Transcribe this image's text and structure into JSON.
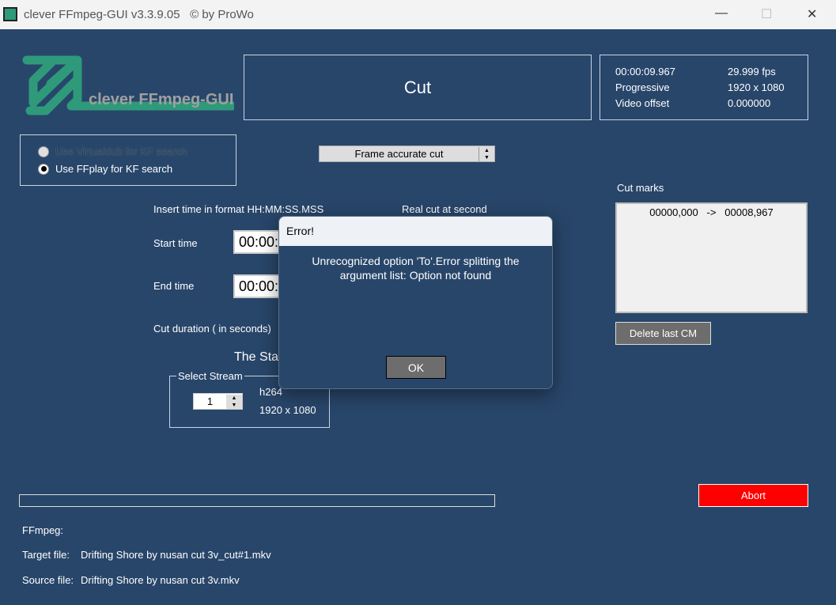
{
  "window": {
    "title": "clever FFmpeg-GUI v3.3.9.05",
    "copyright": "© by ProWo",
    "minimize": "—",
    "maximize": "☐",
    "close": "✕"
  },
  "logo": {
    "text": "clever FFmpeg-GUI",
    "color": "#2e9a7a"
  },
  "mode_title": "Cut",
  "info": {
    "duration": "00:00:09.967",
    "fps": "29.999 fps",
    "scan": "Progressive",
    "resolution": "1920 x 1080",
    "offset_label": "Video offset",
    "offset_value": "0.000000"
  },
  "kf_search": {
    "options": [
      "Use Virtualdub for KF search",
      "Use FFplay for KF search"
    ],
    "selected": 1
  },
  "cut_mode": {
    "selected": "Frame accurate cut"
  },
  "time_hint": "Insert time in format HH:MM:SS.MSS",
  "real_cut_label": "Real cut at second",
  "start_label": "Start time",
  "start_value": "00:00:",
  "end_label": "End time",
  "end_value": "00:00:",
  "duration_label": "Cut duration ( in seconds)",
  "stream_heading": "The Sta",
  "stream": {
    "legend": "Select Stream",
    "value": "1",
    "codec": "h264",
    "resolution": "1920 x 1080"
  },
  "cut_marks": {
    "label": "Cut marks",
    "items": [
      "00000,000   ->   00008,967"
    ],
    "delete_label": "Delete last CM"
  },
  "abort_label": "Abort",
  "abort_color": "#ff0000",
  "progress": 0,
  "status": {
    "ffmpeg_label": "FFmpeg:",
    "target_label": "Target file:",
    "target_value": "Drifting Shore by nusan cut 3v_cut#1.mkv",
    "source_label": "Source file:",
    "source_value": "Drifting Shore by nusan cut 3v.mkv"
  },
  "dialog": {
    "title": "Error!",
    "message": "Unrecognized option 'To'.Error splitting the argument list: Option not found",
    "ok_label": "OK"
  }
}
